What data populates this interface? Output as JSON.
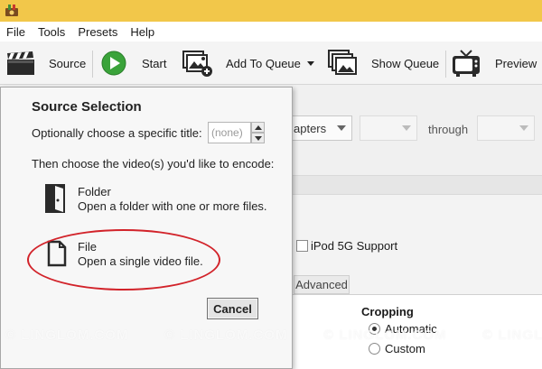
{
  "menu": {
    "items": [
      "File",
      "Tools",
      "Presets",
      "Help"
    ]
  },
  "toolbar": {
    "source_label": "Source",
    "start_label": "Start",
    "add_to_queue_label": "Add To Queue",
    "show_queue_label": "Show Queue",
    "preview_label": "Preview"
  },
  "main": {
    "chapters_combo": "apters",
    "through_label": "through",
    "ipod_label": "iPod 5G Support",
    "advanced_tab": "Advanced",
    "cropping": {
      "title": "Cropping",
      "automatic_label": "Automatic",
      "custom_label": "Custom",
      "selected": "Automatic"
    }
  },
  "source_selection": {
    "title": "Source Selection",
    "choose_title_text": "Optionally choose a specific title:",
    "title_value": "(none)",
    "choose_video_text": "Then choose the video(s) you'd like to encode:",
    "folder": {
      "title": "Folder",
      "description": "Open a folder with one or more files."
    },
    "file": {
      "title": "File",
      "description": "Open a single video file."
    },
    "cancel_label": "Cancel"
  },
  "watermark": {
    "text": "© LINGLOM.COM"
  },
  "colors": {
    "titlebar": "#f2c74a",
    "highlight_ellipse": "#d2232a",
    "start_green": "#3aa33a"
  }
}
